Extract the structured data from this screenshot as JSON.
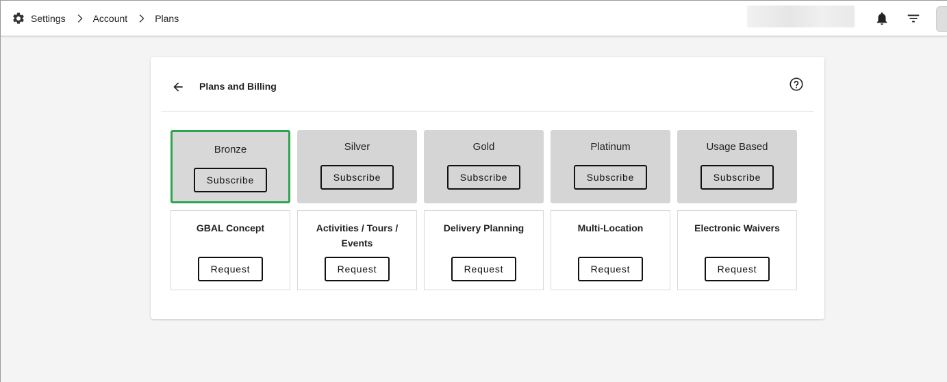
{
  "breadcrumb": {
    "items": [
      "Settings",
      "Account",
      "Plans"
    ]
  },
  "header": {
    "icons": [
      "gear-icon",
      "bell-icon",
      "filter-icon"
    ]
  },
  "card": {
    "title": "Plans and Billing"
  },
  "plans": [
    {
      "name": "Bronze",
      "action": "Subscribe",
      "selected": true
    },
    {
      "name": "Silver",
      "action": "Subscribe",
      "selected": false
    },
    {
      "name": "Gold",
      "action": "Subscribe",
      "selected": false
    },
    {
      "name": "Platinum",
      "action": "Subscribe",
      "selected": false
    },
    {
      "name": "Usage Based",
      "action": "Subscribe",
      "selected": false
    }
  ],
  "addons": [
    {
      "name": "GBAL Concept",
      "action": "Request"
    },
    {
      "name": "Activities / Tours / Events",
      "action": "Request"
    },
    {
      "name": "Delivery Planning",
      "action": "Request"
    },
    {
      "name": "Multi-Location",
      "action": "Request"
    },
    {
      "name": "Electronic Waivers",
      "action": "Request"
    }
  ],
  "colors": {
    "selected_border": "#2ea44f",
    "plan_background": "#d5d5d5",
    "page_background": "#f4f4f4"
  }
}
